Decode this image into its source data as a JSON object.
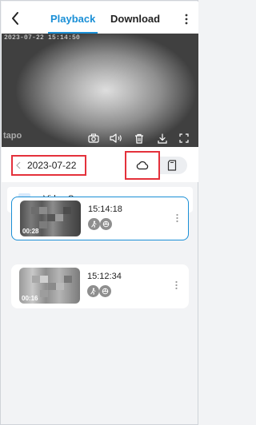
{
  "header": {
    "tabs": [
      {
        "label": "Playback",
        "active": true
      },
      {
        "label": "Download",
        "active": false
      }
    ],
    "back_icon": "chevron-left-icon",
    "more_icon": "vertical-dots-icon",
    "accent_color": "#1a8fd6"
  },
  "video": {
    "timestamp": "2023-07-22  15:14:50",
    "watermark": "tapo",
    "controls": [
      {
        "icon": "camera-icon",
        "label": "Screenshot"
      },
      {
        "icon": "speaker-icon",
        "label": "Volume"
      },
      {
        "icon": "trash-icon",
        "label": "Delete"
      },
      {
        "icon": "download-icon",
        "label": "Download"
      },
      {
        "icon": "fullscreen-icon",
        "label": "Fullscreen"
      }
    ]
  },
  "date_bar": {
    "date": "2023-07-22",
    "storage_options": [
      {
        "icon": "cloud-icon",
        "selected": true
      },
      {
        "icon": "sd-card-icon",
        "selected": false
      }
    ],
    "highlight_color": "#e4313b"
  },
  "summary": {
    "label": "Video Summary",
    "icon": "play-icon"
  },
  "recordings": [
    {
      "time": "15:14:18",
      "duration": "00:28",
      "selected": true,
      "event_icons": [
        "person-motion-icon",
        "vehicle-icon"
      ]
    },
    {
      "time": "15:12:34",
      "duration": "00:16",
      "selected": false,
      "event_icons": [
        "person-motion-icon",
        "vehicle-icon"
      ]
    }
  ]
}
